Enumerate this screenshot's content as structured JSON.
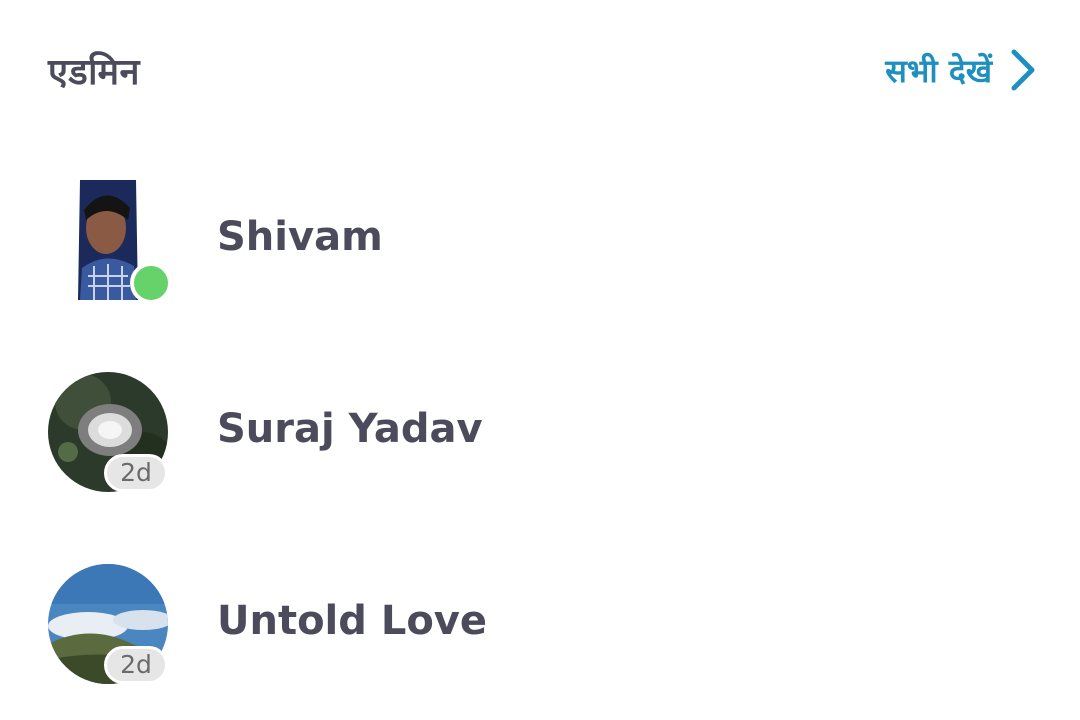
{
  "section": {
    "title": "एडमिन",
    "see_all_label": "सभी देखें",
    "accent_color": "#1f8fbf"
  },
  "members": [
    {
      "name": "Shivam",
      "status": "online",
      "status_color": "#66d36a"
    },
    {
      "name": "Suraj Yadav",
      "last_seen": "2d"
    },
    {
      "name": "Untold Love",
      "last_seen": "2d"
    }
  ]
}
